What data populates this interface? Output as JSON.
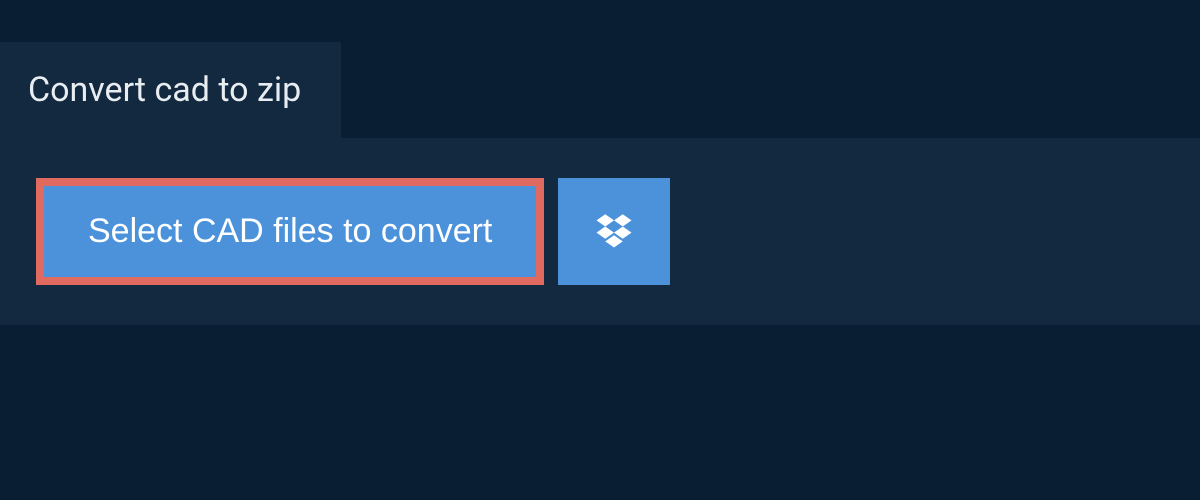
{
  "tab": {
    "title": "Convert cad to zip"
  },
  "actions": {
    "select_label": "Select CAD files to convert"
  },
  "colors": {
    "bg_outer": "#0a1e33",
    "bg_panel": "#13293f",
    "button_primary": "#4b92db",
    "highlight_border": "#e06a5f"
  }
}
